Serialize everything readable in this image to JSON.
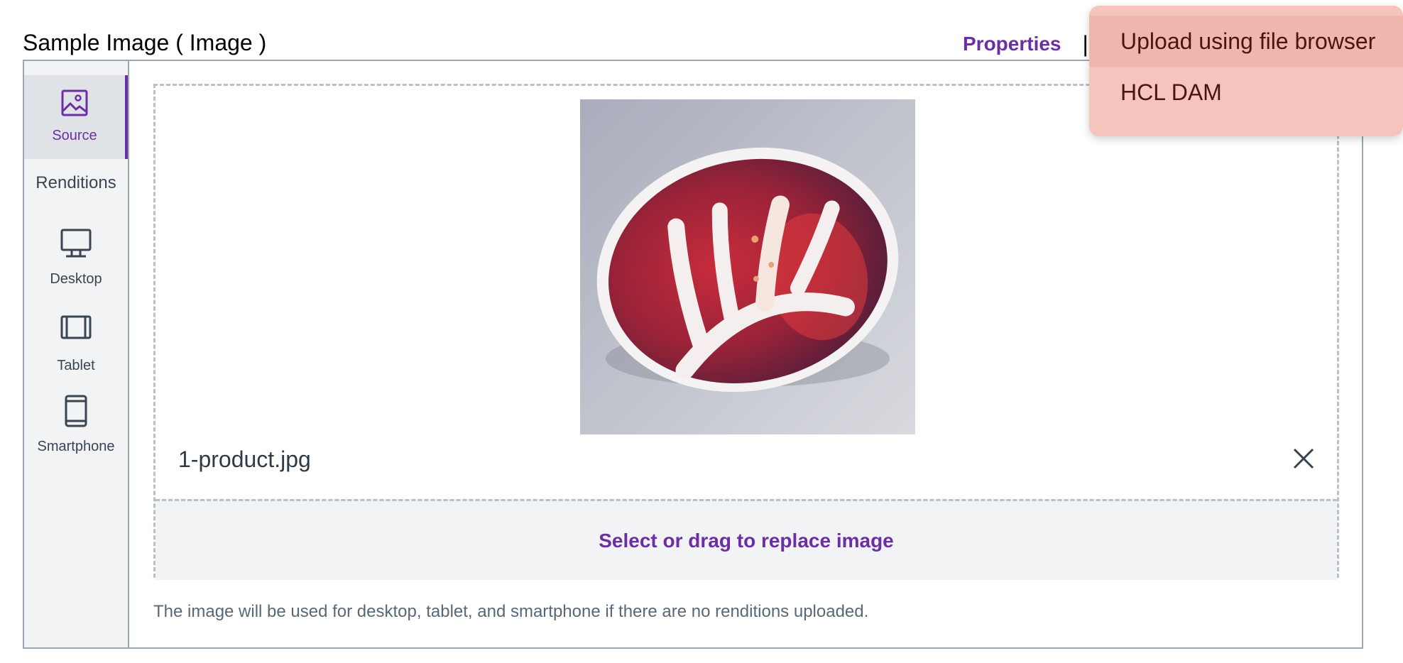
{
  "header": {
    "title": "Sample Image ( Image )",
    "properties_label": "Properties",
    "divider": "|"
  },
  "sidebar": {
    "source_label": "Source",
    "renditions_heading": "Renditions",
    "items": [
      {
        "label": "Desktop",
        "icon": "monitor-icon"
      },
      {
        "label": "Tablet",
        "icon": "tablet-icon"
      },
      {
        "label": "Smartphone",
        "icon": "smartphone-icon"
      }
    ]
  },
  "main": {
    "file_name": "1-product.jpg",
    "replace_label": "Select or drag to replace image",
    "helper_text": "The image will be used for desktop, tablet, and smartphone if there are no renditions uploaded."
  },
  "dropdown": {
    "items": [
      "Upload using file browser",
      "HCL DAM"
    ]
  },
  "colors": {
    "accent": "#6b2fa3",
    "dropdown_bg": "#f5c4bc",
    "sidebar_bg": "#f1f3f5"
  }
}
